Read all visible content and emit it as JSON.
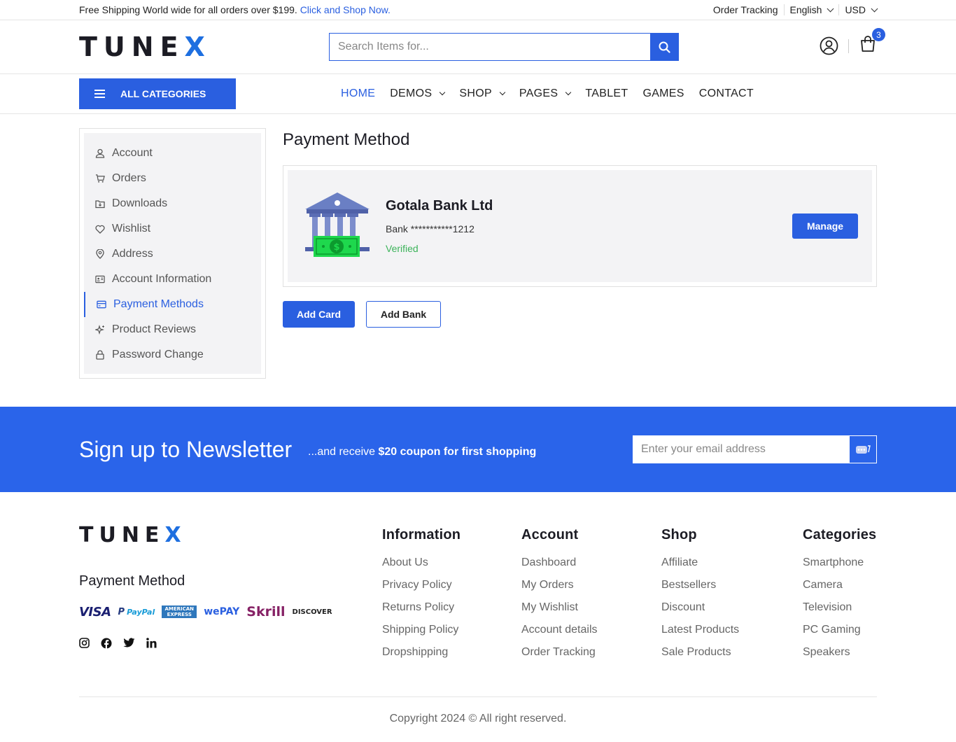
{
  "topbar": {
    "promo_text": "Free Shipping World wide for all orders over $199.",
    "promo_link": "Click and Shop Now.",
    "order_tracking": "Order Tracking",
    "language": "English",
    "currency": "USD"
  },
  "header": {
    "logo_main": "TUNE",
    "logo_accent": "X",
    "search_placeholder": "Search Items for...",
    "cart_count": "3"
  },
  "nav": {
    "all_categories": "ALL CATEGORIES",
    "items": [
      {
        "label": "HOME",
        "active": true
      },
      {
        "label": "DEMOS",
        "dropdown": true
      },
      {
        "label": "SHOP",
        "dropdown": true
      },
      {
        "label": "PAGES",
        "dropdown": true
      },
      {
        "label": "TABLET"
      },
      {
        "label": "GAMES"
      },
      {
        "label": "CONTACT"
      }
    ]
  },
  "sidebar": {
    "items": [
      {
        "label": "Account",
        "icon": "user-icon"
      },
      {
        "label": "Orders",
        "icon": "cart-icon"
      },
      {
        "label": "Downloads",
        "icon": "download-icon"
      },
      {
        "label": "Wishlist",
        "icon": "heart-icon"
      },
      {
        "label": "Address",
        "icon": "location-icon"
      },
      {
        "label": "Account Information",
        "icon": "id-card-icon"
      },
      {
        "label": "Payment Methods",
        "icon": "credit-card-icon",
        "active": true
      },
      {
        "label": "Product Reviews",
        "icon": "sparkle-icon"
      },
      {
        "label": "Password Change",
        "icon": "lock-icon"
      }
    ]
  },
  "main": {
    "title": "Payment Method",
    "bank": {
      "name": "Gotala Bank Ltd",
      "account": "Bank ***********1212",
      "status": "Verified",
      "manage_label": "Manage"
    },
    "add_card_label": "Add Card",
    "add_bank_label": "Add Bank"
  },
  "newsletter": {
    "title": "Sign up to Newsletter",
    "sub_prefix": "...and receive ",
    "sub_bold": "$20 coupon for first shopping",
    "email_placeholder": "Enter your email address"
  },
  "footer": {
    "logo_main": "TUNE",
    "logo_accent": "X",
    "payment_title": "Payment Method",
    "payment_logos": [
      "VISA",
      "PayPal",
      "AMERICAN EXPRESS",
      "wePAY",
      "Skrill",
      "DISCOVER"
    ],
    "columns": [
      {
        "title": "Information",
        "links": [
          "About Us",
          "Privacy Policy",
          "Returns Policy",
          "Shipping Policy",
          "Dropshipping"
        ]
      },
      {
        "title": "Account",
        "links": [
          "Dashboard",
          "My Orders",
          "My Wishlist",
          "Account details",
          "Order Tracking"
        ]
      },
      {
        "title": "Shop",
        "links": [
          "Affiliate",
          "Bestsellers",
          "Discount",
          "Latest Products",
          "Sale Products"
        ]
      },
      {
        "title": "Categories",
        "links": [
          "Smartphone",
          "Camera",
          "Television",
          "PC Gaming",
          "Speakers"
        ]
      }
    ],
    "copyright": "Copyright 2024 © All right reserved."
  },
  "colors": {
    "primary": "#2a5fe0",
    "newsletter_bg": "#2a64ea",
    "verified": "#3cb35a"
  }
}
